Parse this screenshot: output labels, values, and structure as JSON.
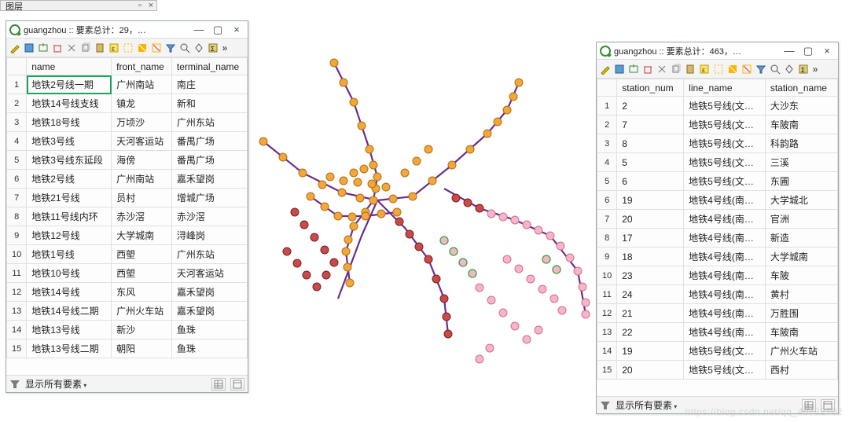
{
  "layers_panel": {
    "title": "图层"
  },
  "left_window": {
    "title": "guangzhou :: 要素总计：29，…",
    "status": "显示所有要素",
    "columns": [
      "name",
      "front_name",
      "terminal_name"
    ],
    "rows": [
      {
        "n": "1",
        "name": "地铁2号线一期",
        "front": "广州南站",
        "term": "南庄",
        "sel": true
      },
      {
        "n": "2",
        "name": "地铁14号线支线",
        "front": "镇龙",
        "term": "新和"
      },
      {
        "n": "3",
        "name": "地铁18号线",
        "front": "万顷沙",
        "term": "广州东站"
      },
      {
        "n": "4",
        "name": "地铁3号线",
        "front": "天河客运站",
        "term": "番禺广场"
      },
      {
        "n": "5",
        "name": "地铁3号线东延段",
        "front": "海傍",
        "term": "番禺广场"
      },
      {
        "n": "6",
        "name": "地铁2号线",
        "front": "广州南站",
        "term": "嘉禾望岗"
      },
      {
        "n": "7",
        "name": "地铁21号线",
        "front": "员村",
        "term": "增城广场"
      },
      {
        "n": "8",
        "name": "地铁11号线内环",
        "front": "赤沙滘",
        "term": "赤沙滘"
      },
      {
        "n": "9",
        "name": "地铁12号线",
        "front": "大学城南",
        "term": "浔峰岗"
      },
      {
        "n": "10",
        "name": "地铁1号线",
        "front": "西塱",
        "term": "广州东站"
      },
      {
        "n": "11",
        "name": "地铁10号线",
        "front": "西塱",
        "term": "天河客运站"
      },
      {
        "n": "12",
        "name": "地铁14号线",
        "front": "东风",
        "term": "嘉禾望岗"
      },
      {
        "n": "13",
        "name": "地铁14号线二期",
        "front": "广州火车站",
        "term": "嘉禾望岗"
      },
      {
        "n": "14",
        "name": "地铁13号线",
        "front": "新沙",
        "term": "鱼珠"
      },
      {
        "n": "15",
        "name": "地铁13号线二期",
        "front": "朝阳",
        "term": "鱼珠"
      }
    ]
  },
  "right_window": {
    "title": "guangzhou :: 要素总计：463，…",
    "status": "显示所有要素",
    "columns": [
      "station_num",
      "line_name",
      "station_name"
    ],
    "rows": [
      {
        "n": "1",
        "num": "2",
        "line": "地铁5号线(文…",
        "st": "大沙东"
      },
      {
        "n": "2",
        "num": "7",
        "line": "地铁5号线(文…",
        "st": "车陂南"
      },
      {
        "n": "3",
        "num": "8",
        "line": "地铁5号线(文…",
        "st": "科韵路"
      },
      {
        "n": "4",
        "num": "5",
        "line": "地铁5号线(文…",
        "st": "三溪"
      },
      {
        "n": "5",
        "num": "6",
        "line": "地铁5号线(文…",
        "st": "东圃"
      },
      {
        "n": "6",
        "num": "19",
        "line": "地铁4号线(南…",
        "st": "大学城北"
      },
      {
        "n": "7",
        "num": "20",
        "line": "地铁4号线(南…",
        "st": "官洲"
      },
      {
        "n": "8",
        "num": "17",
        "line": "地铁4号线(南…",
        "st": "新造"
      },
      {
        "n": "9",
        "num": "18",
        "line": "地铁4号线(南…",
        "st": "大学城南"
      },
      {
        "n": "10",
        "num": "23",
        "line": "地铁4号线(南…",
        "st": "车陂"
      },
      {
        "n": "11",
        "num": "24",
        "line": "地铁4号线(南…",
        "st": "黄村"
      },
      {
        "n": "12",
        "num": "21",
        "line": "地铁4号线(南…",
        "st": "万胜围"
      },
      {
        "n": "13",
        "num": "22",
        "line": "地铁4号线(南…",
        "st": "车陂南"
      },
      {
        "n": "14",
        "num": "19",
        "line": "地铁5号线(文…",
        "st": "广州火车站"
      },
      {
        "n": "15",
        "num": "20",
        "line": "地铁5号线(文…",
        "st": "西村"
      }
    ]
  },
  "watermark": "https://blog.csdn.net/qq_40782702",
  "map": {
    "colors": {
      "line_purple": "#6b2c91",
      "line_orange": "#f0a020",
      "node_orange": "#f2a63e",
      "node_orange_stroke": "#b36f0a",
      "node_red": "#c94a4a",
      "node_red_stroke": "#7a1f1f",
      "node_pink": "#f5b6c8",
      "node_pink_stroke": "#d46b90",
      "node_green_stroke": "#3aa440"
    }
  }
}
